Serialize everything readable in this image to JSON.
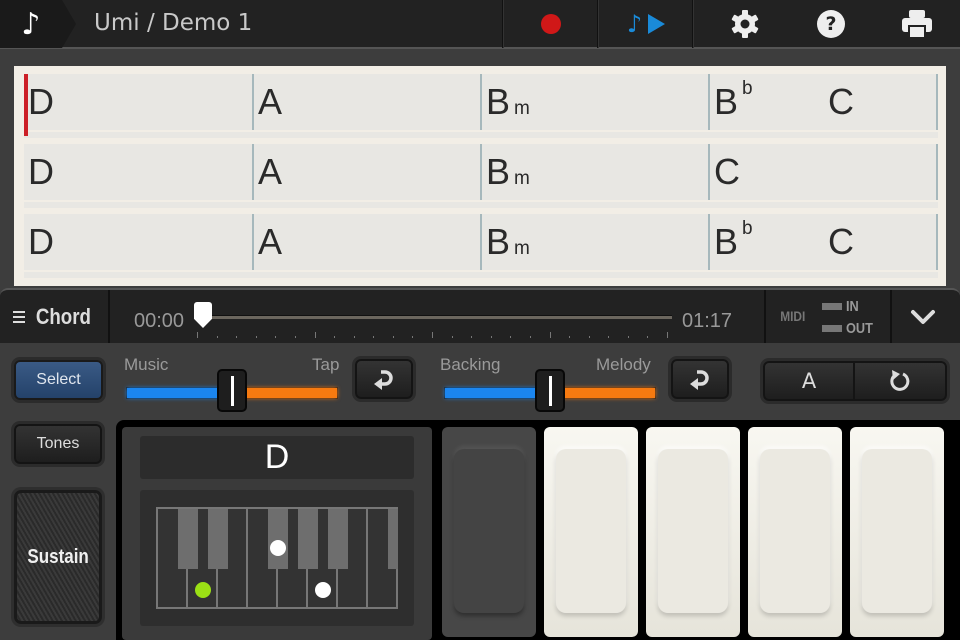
{
  "header": {
    "home_icon": "music-note-icon",
    "title": "Umi / Demo 1",
    "buttons": [
      {
        "name": "record",
        "icon": "record-icon",
        "color": "#d01818"
      },
      {
        "name": "play-melody",
        "icon": "note-play-icon",
        "color": "#1a8ad8"
      },
      {
        "name": "settings",
        "icon": "gear-icon"
      },
      {
        "name": "help",
        "icon": "help-icon",
        "glyph": "?"
      },
      {
        "name": "print",
        "icon": "printer-icon"
      }
    ]
  },
  "sheet": {
    "rows": [
      {
        "measures": [
          {
            "chords": [
              {
                "root": "D",
                "quality": "",
                "accidental": ""
              }
            ]
          },
          {
            "chords": [
              {
                "root": "A",
                "quality": "",
                "accidental": ""
              }
            ]
          },
          {
            "chords": [
              {
                "root": "B",
                "quality": "m",
                "accidental": ""
              }
            ]
          },
          {
            "chords": [
              {
                "root": "B",
                "quality": "",
                "accidental": "b"
              },
              {
                "root": "C",
                "quality": "",
                "accidental": ""
              }
            ]
          }
        ]
      },
      {
        "measures": [
          {
            "chords": [
              {
                "root": "D",
                "quality": "",
                "accidental": ""
              }
            ]
          },
          {
            "chords": [
              {
                "root": "A",
                "quality": "",
                "accidental": ""
              }
            ]
          },
          {
            "chords": [
              {
                "root": "B",
                "quality": "m",
                "accidental": ""
              }
            ]
          },
          {
            "chords": [
              {
                "root": "C",
                "quality": "",
                "accidental": ""
              }
            ]
          }
        ]
      },
      {
        "measures": [
          {
            "chords": [
              {
                "root": "D",
                "quality": "",
                "accidental": ""
              }
            ]
          },
          {
            "chords": [
              {
                "root": "A",
                "quality": "",
                "accidental": ""
              }
            ]
          },
          {
            "chords": [
              {
                "root": "B",
                "quality": "m",
                "accidental": ""
              }
            ]
          },
          {
            "chords": [
              {
                "root": "B",
                "quality": "",
                "accidental": "b"
              },
              {
                "root": "C",
                "quality": "",
                "accidental": ""
              }
            ]
          }
        ]
      }
    ],
    "cursor_color": "#cc1f26"
  },
  "transport": {
    "menu_label": "Chord",
    "time_current": "00:00",
    "time_total": "01:17",
    "position_fraction": 0.0,
    "midi_label": "MIDI",
    "midi_in": "IN",
    "midi_out": "OUT",
    "expand_icon": "chevron-down-icon"
  },
  "controls": {
    "select_label": "Select",
    "tones_label": "Tones",
    "sustain_label": "Sustain",
    "mix1": {
      "left": "Music",
      "right": "Tap",
      "value": 0.5
    },
    "mix2": {
      "left": "Backing",
      "right": "Melody",
      "value": 0.5
    },
    "reset_icon": "return-arrow-icon",
    "ab_label": "A",
    "loop_icon": "refresh-icon",
    "colors": {
      "blue": "#1b86f0",
      "orange": "#f77a10",
      "select": "#2e4f7a"
    }
  },
  "chord_display": {
    "name": "D",
    "root_color": "#9be015",
    "keyboard": {
      "white_keys": [
        "C",
        "D",
        "E",
        "F",
        "G",
        "A",
        "B",
        "C"
      ],
      "black_keys": [
        "C#",
        "D#",
        "F#",
        "G#",
        "A#",
        "C#"
      ],
      "root": "D",
      "notes": [
        "F#",
        "A"
      ]
    }
  },
  "pads": [
    {
      "state": "active"
    },
    {
      "state": "idle"
    },
    {
      "state": "idle"
    },
    {
      "state": "idle"
    },
    {
      "state": "idle"
    }
  ]
}
